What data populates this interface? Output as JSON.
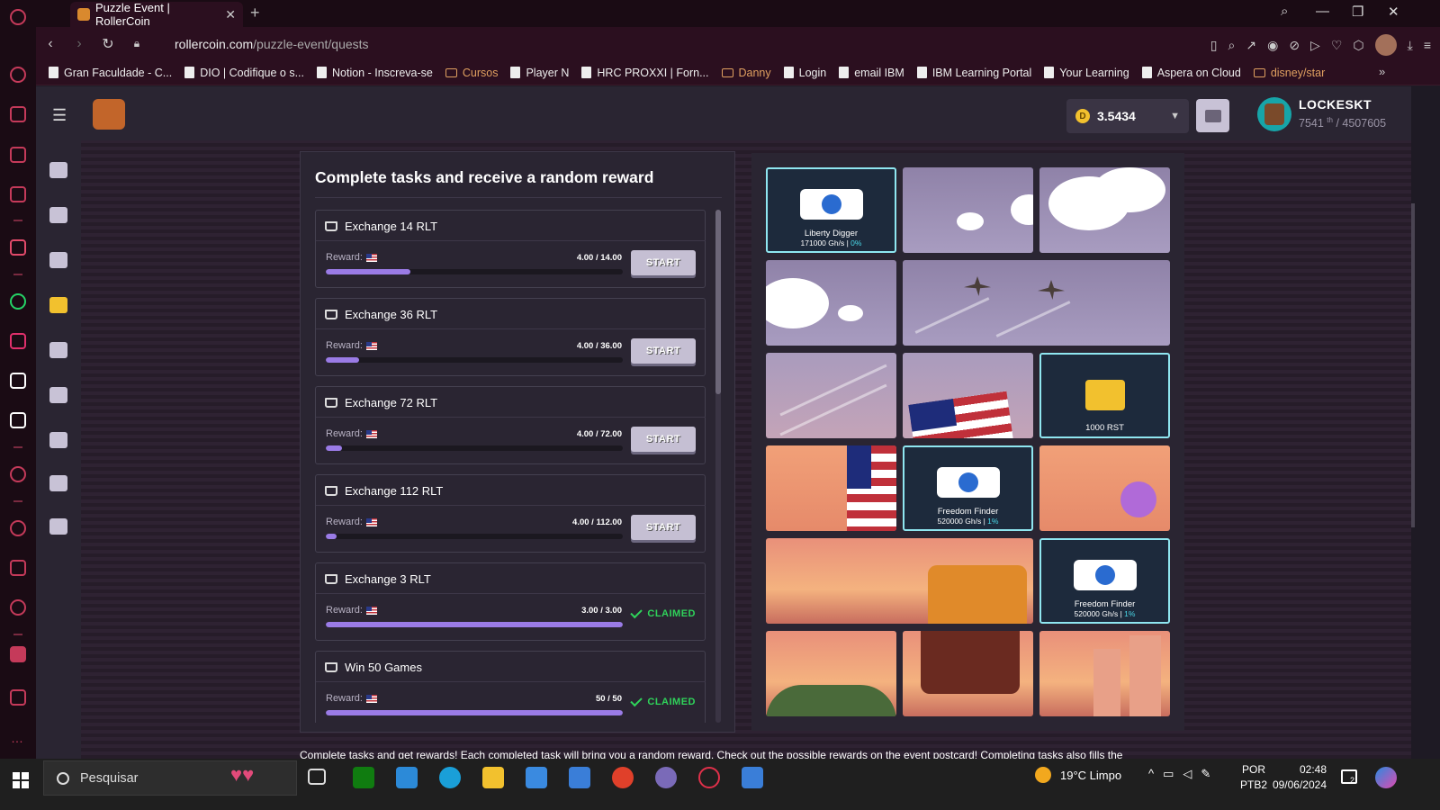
{
  "browser": {
    "tab_title": "Puzzle Event | RollerCoin",
    "url_host": "rollercoin.com",
    "url_path": "/puzzle-event/quests",
    "bookmarks": [
      {
        "label": "Gran Faculdade - C...",
        "type": "page"
      },
      {
        "label": "DIO | Codifique o s...",
        "type": "page"
      },
      {
        "label": "Notion - Inscreva-se",
        "type": "page"
      },
      {
        "label": "Cursos",
        "type": "folder"
      },
      {
        "label": "Player N",
        "type": "page"
      },
      {
        "label": "HRC PROXXI | Forn...",
        "type": "page"
      },
      {
        "label": "Danny",
        "type": "folder"
      },
      {
        "label": "Login",
        "type": "page"
      },
      {
        "label": "email IBM",
        "type": "page"
      },
      {
        "label": "IBM Learning Portal",
        "type": "page"
      },
      {
        "label": "Your Learning",
        "type": "page"
      },
      {
        "label": "Aspera on Cloud",
        "type": "page"
      },
      {
        "label": "disney/star",
        "type": "folder"
      }
    ]
  },
  "header": {
    "balance": "3.5434",
    "coin_symbol": "D",
    "username": "LOCKESKT",
    "rank": "7541",
    "rank_suffix": "th",
    "rank_total": "/ 4507605"
  },
  "quests": {
    "title": "Complete tasks and receive a random reward",
    "reward_label": "Reward:",
    "tasks": [
      {
        "name": "Exchange 14 RLT",
        "icon": "cart-icon",
        "progress": "4.00 / 14.00",
        "fraction": 0.286,
        "state": "START"
      },
      {
        "name": "Exchange 36 RLT",
        "icon": "cart-icon",
        "progress": "4.00 / 36.00",
        "fraction": 0.111,
        "state": "START"
      },
      {
        "name": "Exchange 72 RLT",
        "icon": "cart-icon",
        "progress": "4.00 / 72.00",
        "fraction": 0.056,
        "state": "START"
      },
      {
        "name": "Exchange 112 RLT",
        "icon": "cart-icon",
        "progress": "4.00 / 112.00",
        "fraction": 0.036,
        "state": "START"
      },
      {
        "name": "Exchange 3 RLT",
        "icon": "cart-icon",
        "progress": "3.00 / 3.00",
        "fraction": 1.0,
        "state": "CLAIMED"
      },
      {
        "name": "Win 50 Games",
        "icon": "gamepad-icon",
        "progress": "50 / 50",
        "fraction": 1.0,
        "state": "CLAIMED"
      }
    ]
  },
  "postcard": {
    "rewards": [
      {
        "name": "Liberty Digger",
        "power": "171000 Gh/s",
        "bonus": "0%"
      },
      {
        "name": "1000 RST",
        "power": "",
        "bonus": ""
      },
      {
        "name": "Freedom Finder",
        "power": "520000 Gh/s",
        "bonus": "1%"
      },
      {
        "name": "Freedom Finder",
        "power": "520000 Gh/s",
        "bonus": "1%"
      }
    ]
  },
  "footer_text": "Complete tasks and get rewards! Each completed task will bring you a random reward. Check out the possible rewards on the event postcard! Completing tasks also fills the",
  "taskbar": {
    "search_placeholder": "Pesquisar",
    "weather": "19°C  Limpo",
    "lang1": "POR",
    "lang2": "PTB2",
    "time": "02:48",
    "date": "09/06/2024",
    "notif_count": "2"
  },
  "colors": {
    "accent": "#9a7be6",
    "claimed": "#2fd35a",
    "panel": "#2a2532",
    "reward_border": "#8fe6f0"
  }
}
